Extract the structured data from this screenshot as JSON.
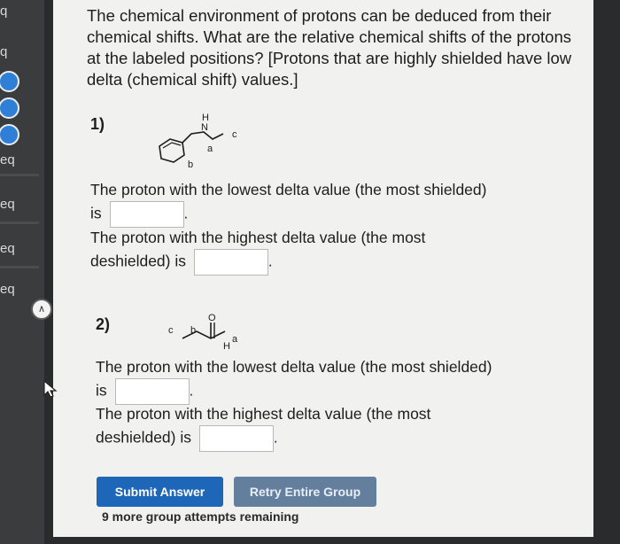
{
  "sidebar": {
    "labels": [
      "q",
      "q",
      "eq",
      "eq",
      "eq",
      "eq"
    ]
  },
  "question": {
    "intro": "The chemical environment of protons can be deduced from their chemical shifts. What are the relative chemical shifts of the protons at the labeled positions? [Protons that are highly shielded have low delta (chemical shift) values.]"
  },
  "part1": {
    "number": "1)",
    "lowest_prompt_a": "The proton with the lowest delta value (the most shielded)",
    "lowest_prompt_b": "is",
    "highest_prompt_a": "The proton with the highest delta value (the most",
    "highest_prompt_b": "deshielded) is",
    "molecule_labels": {
      "h": "H",
      "n": "N",
      "a": "a",
      "b": "b",
      "c": "c"
    },
    "lowest_value": "",
    "highest_value": ""
  },
  "part2": {
    "number": "2)",
    "lowest_prompt_a": "The proton with the lowest delta value (the most shielded)",
    "lowest_prompt_b": "is",
    "highest_prompt_a": "The proton with the highest delta value (the most",
    "highest_prompt_b": "deshielded) is",
    "molecule_labels": {
      "o": "O",
      "h": "H",
      "a": "a",
      "b": "b",
      "c": "c"
    },
    "lowest_value": "",
    "highest_value": ""
  },
  "buttons": {
    "submit": "Submit Answer",
    "retry": "Retry Entire Group"
  },
  "attempts_text": "9 more group attempts remaining",
  "colors": {
    "submit_button": "#1e66b8",
    "retry_button": "#647f9e",
    "panel_background": "#f1f1ef",
    "sidebar_circle": "#2f7fd6"
  }
}
